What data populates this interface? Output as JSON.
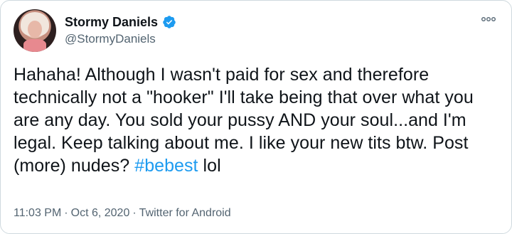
{
  "user": {
    "display_name": "Stormy Daniels",
    "handle": "@StormyDaniels",
    "verified": true
  },
  "tweet": {
    "text_before_hashtag": "Hahaha! Although I wasn't paid for sex and therefore technically not a \"hooker\" I'll take being that over what you are any day. You sold your pussy AND your soul...and I'm legal. Keep talking about me. I like your new tits btw. Post (more) nudes? ",
    "hashtag": "#bebest",
    "text_after_hashtag": " lol"
  },
  "meta": {
    "time": "11:03 PM",
    "sep1": "·",
    "date": "Oct 6, 2020",
    "sep2": "·",
    "source": "Twitter for Android"
  },
  "colors": {
    "accent": "#1d9bf0",
    "text_primary": "#0f1419",
    "text_secondary": "#536471"
  },
  "icons": {
    "verified": "verified-badge-icon",
    "more": "more-options-icon"
  }
}
